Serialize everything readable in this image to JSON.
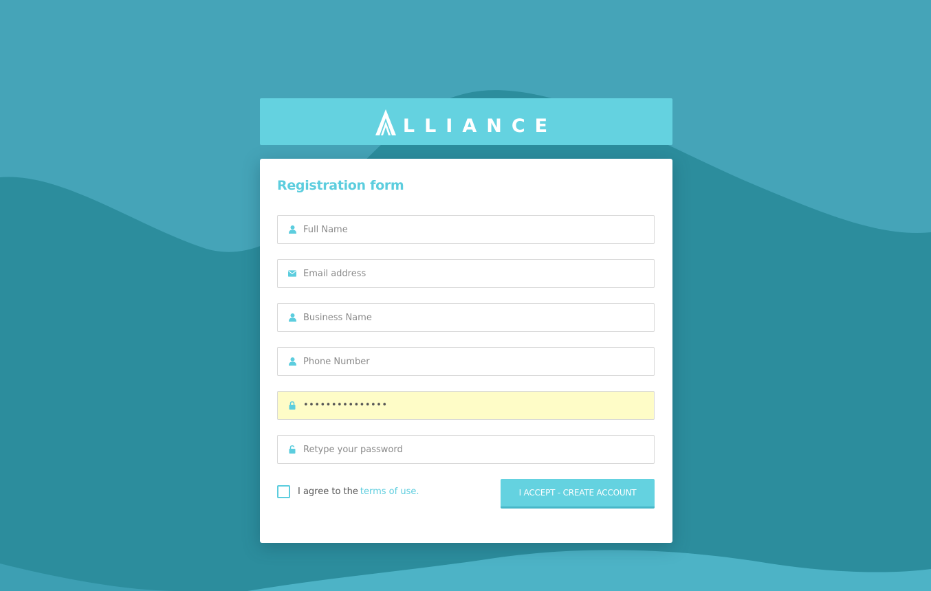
{
  "brand": {
    "name": "LLIANCE",
    "logo_text_full": "ALLIANCE"
  },
  "form": {
    "title": "Registration form",
    "fields": [
      {
        "name": "full-name",
        "placeholder": "Full Name",
        "icon": "user-icon",
        "value": ""
      },
      {
        "name": "email",
        "placeholder": "Email address",
        "icon": "envelope-icon",
        "value": ""
      },
      {
        "name": "business-name",
        "placeholder": "Business Name",
        "icon": "user-icon",
        "value": ""
      },
      {
        "name": "phone-number",
        "placeholder": "Phone Number",
        "icon": "user-icon",
        "value": ""
      },
      {
        "name": "password",
        "placeholder": "",
        "icon": "lock-icon",
        "value": "•••••••••••••••"
      },
      {
        "name": "retype-password",
        "placeholder": "Retype your password",
        "icon": "unlock-icon",
        "value": ""
      }
    ],
    "agree_text": "I agree to the",
    "terms_link": "terms of use.",
    "submit_label": "I ACCEPT - CREATE ACCOUNT"
  },
  "colors": {
    "background": "#45a4b8",
    "wave_dark": "#2b8c9c",
    "accent": "#5ccdde",
    "logo_bar": "#64d2e0",
    "autofill": "#fefcc7"
  }
}
